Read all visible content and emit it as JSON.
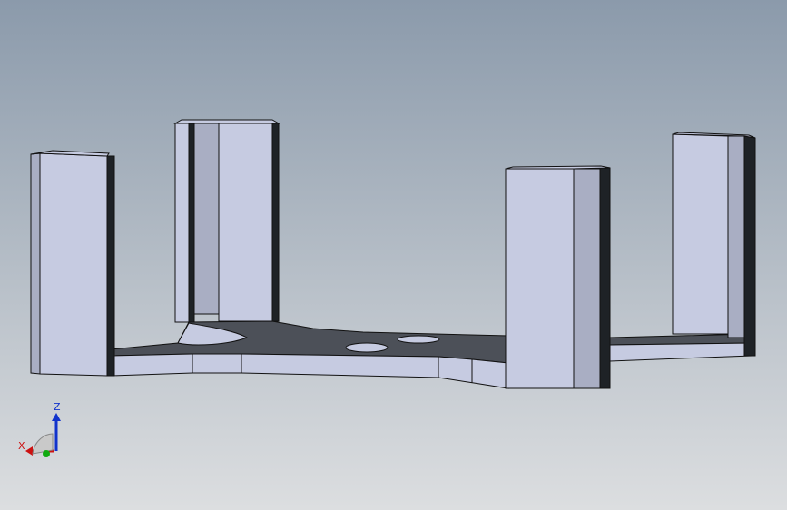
{
  "viewport": {
    "background_top": "#8b9aab",
    "background_bottom": "#dcdee0"
  },
  "model": {
    "face_light": "#c6cbe1",
    "face_mid": "#a9aec3",
    "face_dark": "#1e2226",
    "plate_top": "#4c5058",
    "edge": "#111111"
  },
  "triad": {
    "x_label": "X",
    "z_label": "Z",
    "x_color": "#cc1111",
    "y_color": "#11aa11",
    "z_color": "#1133cc"
  }
}
